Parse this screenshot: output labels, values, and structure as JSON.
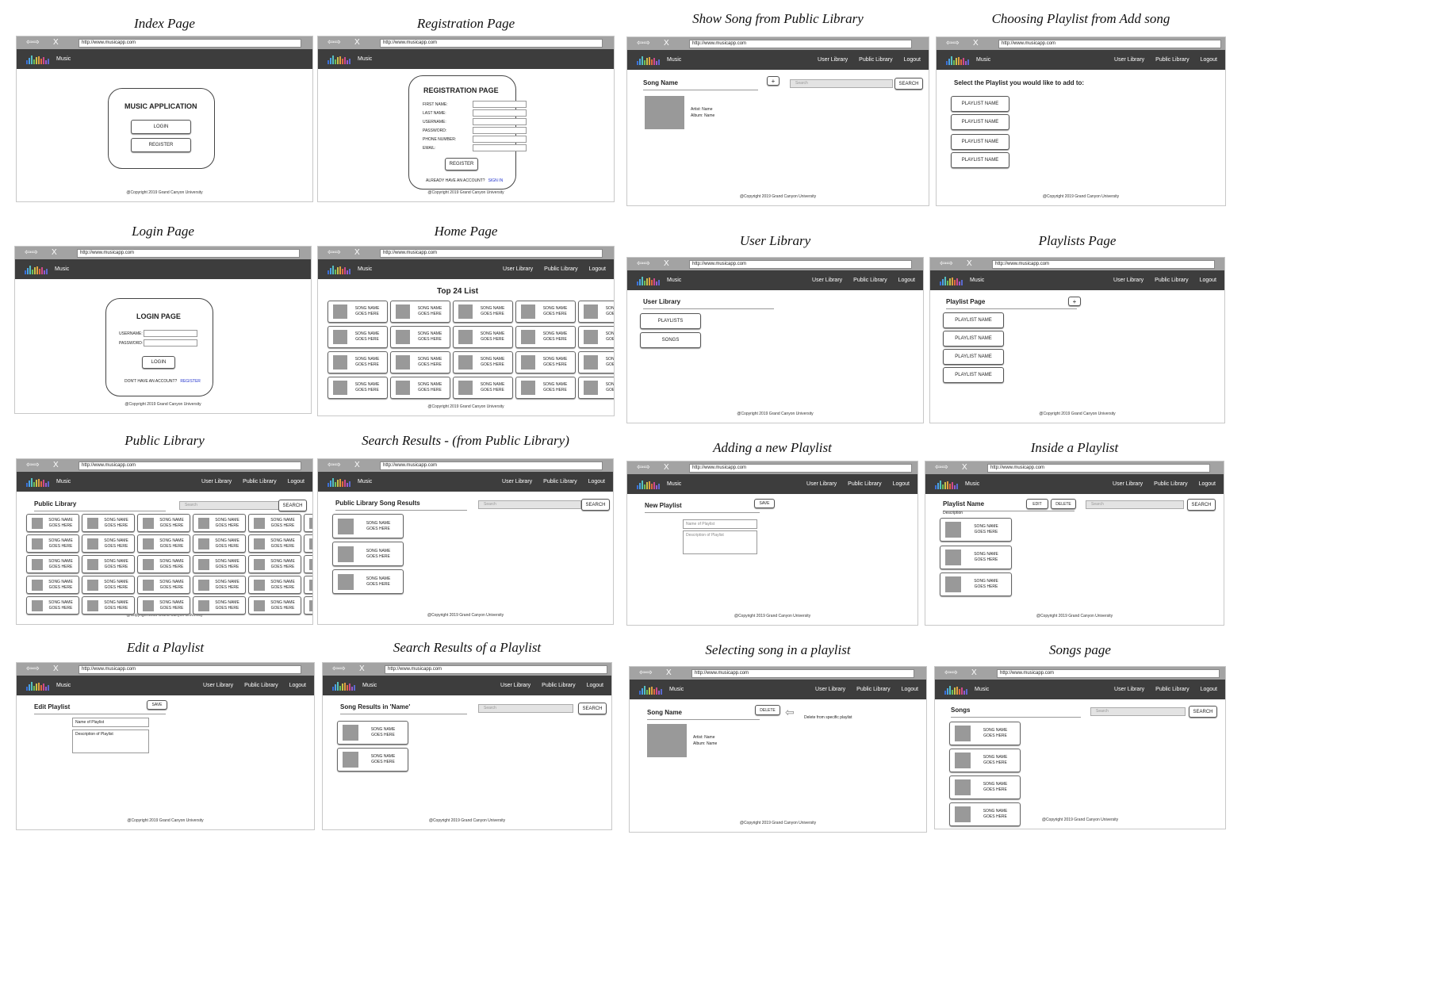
{
  "frames": {
    "index": {
      "title": "Index Page"
    },
    "registration": {
      "title": "Registration Page"
    },
    "show_song": {
      "title": "Show Song from Public Library"
    },
    "choosing": {
      "title": "Choosing Playlist from Add song"
    },
    "login": {
      "title": "Login Page"
    },
    "home": {
      "title": "Home Page"
    },
    "user_library": {
      "title": "User Library"
    },
    "playlists": {
      "title": "Playlists Page"
    },
    "public_library": {
      "title": "Public Library"
    },
    "search_public": {
      "title": "Search Results - (from Public Library)"
    },
    "add_playlist": {
      "title": "Adding a new Playlist"
    },
    "inside_playlist": {
      "title": "Inside a Playlist"
    },
    "edit_playlist": {
      "title": "Edit a Playlist"
    },
    "search_playlist": {
      "title": "Search Results of a Playlist"
    },
    "select_song": {
      "title": "Selecting song in a playlist"
    },
    "songs": {
      "title": "Songs page"
    }
  },
  "common": {
    "url": "http://www.musicapp.com",
    "close": "X",
    "back_forward": "⇦⇨",
    "brand": "Music",
    "nav_user_library": "User Library",
    "nav_public_library": "Public Library",
    "nav_logout": "Logout",
    "copyright": "@Copyright 2019 Grand Canyon University",
    "search_placeholder": "Search",
    "search_button": "SEARCH",
    "song_line1": "SONG NAME",
    "song_line2": "GOES HERE",
    "playlist_name": "PLAYLIST NAME",
    "logo_colors": [
      "#3b6fd8",
      "#4aa3e8",
      "#55c0c0",
      "#6bbf59",
      "#c9c24a",
      "#e0a040",
      "#e06a40",
      "#d04a8a",
      "#9a5ad0",
      "#5a6ad0"
    ]
  },
  "index": {
    "heading": "MUSIC APPLICATION",
    "login": "LOGIN",
    "register": "REGISTER"
  },
  "registration": {
    "heading": "REGISTRATION PAGE",
    "fields": [
      "FIRST NAME:",
      "LAST NAME:",
      "USERNAME:",
      "PASSWORD:",
      "PHONE NUMBER:",
      "EMAIL:"
    ],
    "register": "REGISTER",
    "already": "ALREADY HAVE AN ACCOUNT?",
    "sign_in": "SIGN IN"
  },
  "show_song": {
    "section": "Song Name",
    "plus": "+",
    "artist": "Artist: Name",
    "album": "Album: Name"
  },
  "choosing": {
    "prompt": "Select the Playlist you would like to add to:"
  },
  "login": {
    "heading": "LOGIN PAGE",
    "username": "USERNAME:",
    "password": "PASSWORD:",
    "login": "LOGIN",
    "no_account": "DON'T HAVE AN ACCOUNT?",
    "register": "REGISTER"
  },
  "home": {
    "heading": "Top 24 List"
  },
  "user_library": {
    "section": "User Library",
    "playlists": "PLAYLISTS",
    "songs": "SONGS"
  },
  "playlists": {
    "section": "Playlist Page",
    "plus": "+"
  },
  "public_library": {
    "section": "Public Library"
  },
  "search_public": {
    "section": "Public Library Song Results"
  },
  "add_playlist": {
    "section": "New Playlist",
    "save": "SAVE",
    "name_ph": "Name of Playlist",
    "desc_ph": "Description of Playlist"
  },
  "inside_playlist": {
    "section": "Playlist Name",
    "description": "Description",
    "edit": "EDIT",
    "delete": "DELETE"
  },
  "edit_playlist": {
    "section": "Edit Playlist",
    "save": "SAVE",
    "name_val": "Name of Playlist",
    "desc_val": "Description of Playlist"
  },
  "search_playlist": {
    "section": "Song Results in 'Name'"
  },
  "select_song": {
    "section": "Song Name",
    "delete": "DELETE",
    "note": "Delete from specific playlist",
    "artist": "Artist: Name",
    "album": "Album: Name"
  },
  "songs": {
    "section": "Songs"
  }
}
